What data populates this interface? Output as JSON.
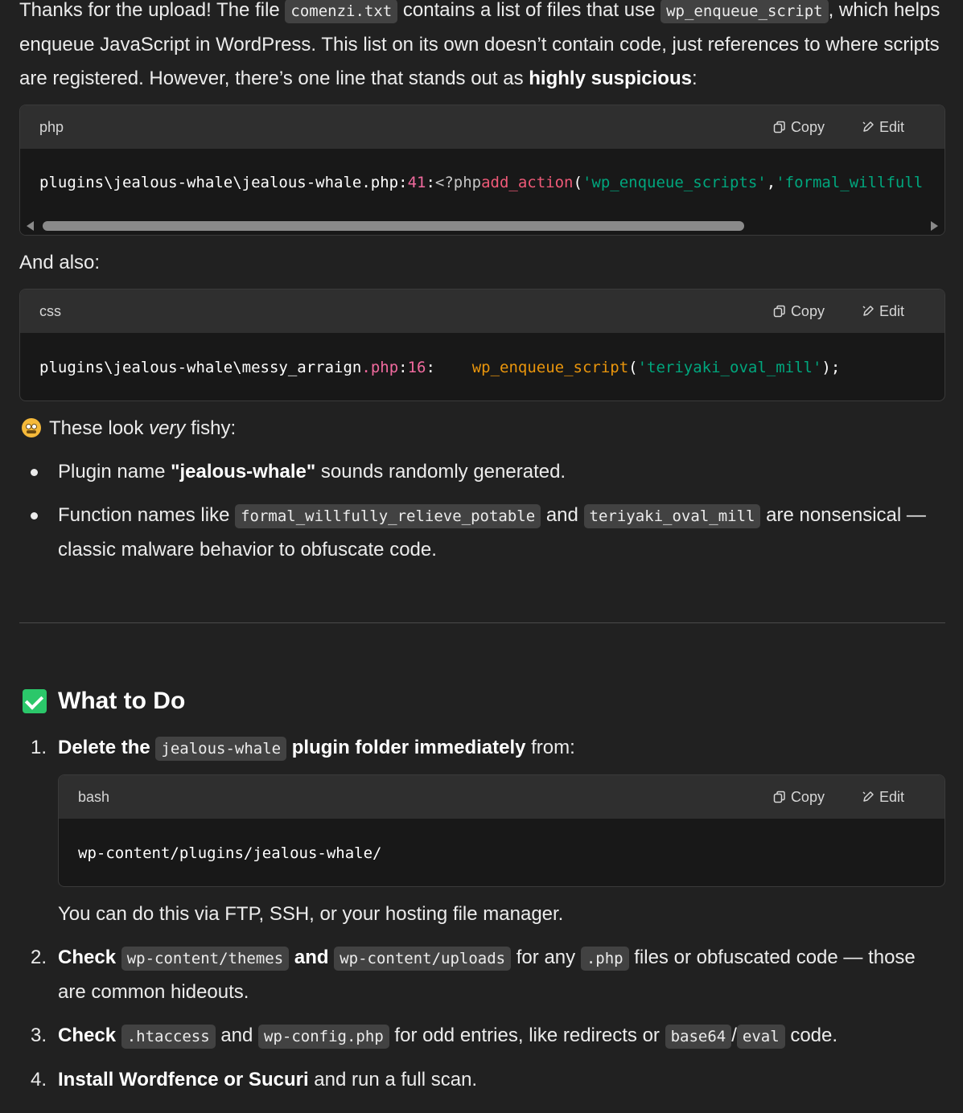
{
  "intro": {
    "t1": "Thanks for the upload! The file ",
    "c1": "comenzi.txt",
    "t2": " contains a list of files that use ",
    "c2": "wp_enqueue_script",
    "t3": ", which helps enqueue JavaScript in WordPress. This list on its own doesn’t contain code, just references to where scripts are registered. However, there’s one line that stands out as ",
    "b1": "highly suspicious",
    "t4": ":"
  },
  "code1": {
    "lang": "php",
    "copy_label": "Copy",
    "edit_label": "Edit",
    "path": "plugins\\jealous-whale\\jealous-whale.php:",
    "line": "41",
    "colon": ":",
    "open_tag": "<?php ",
    "fn": "add_action",
    "paren": "(",
    "arg1": "'wp_enqueue_scripts'",
    "comma": ", ",
    "arg2": "'formal_willfull"
  },
  "and_also": "And also:",
  "code2": {
    "lang": "css",
    "copy_label": "Copy",
    "edit_label": "Edit",
    "path": "plugins\\jealous-whale\\messy_arraign",
    "ext": ".php",
    "colon": ":",
    "line": "16",
    "sep": ":    ",
    "fn": "wp_enqueue_script",
    "paren": "(",
    "arg": "'teriyaki_oval_mill'",
    "close": ");"
  },
  "fishy": {
    "t1": "These look ",
    "em": "very",
    "t2": " fishy:"
  },
  "bullets": {
    "b1_t1": "Plugin name ",
    "b1_b": "\"jealous-whale\"",
    "b1_t2": " sounds randomly generated.",
    "b2_t1": "Function names like ",
    "b2_c1": "formal_willfully_relieve_potable",
    "b2_t2": " and ",
    "b2_c2": "teriyaki_oval_mill",
    "b2_t3": " are nonsensical — classic malware behavior to obfuscate code."
  },
  "section_title": "What to Do",
  "steps": {
    "s1_num": "1.",
    "s1_b1": "Delete the ",
    "s1_c": "jealous-whale",
    "s1_b2": " plugin folder immediately",
    "s1_t": " from:",
    "s1_note": "You can do this via FTP, SSH, or your hosting file manager.",
    "s2_num": "2.",
    "s2_b1": "Check ",
    "s2_c1": "wp-content/themes",
    "s2_b2": " and ",
    "s2_c2": "wp-content/uploads",
    "s2_t1": " for any ",
    "s2_c3": ".php",
    "s2_t2": " files or obfuscated code — those are common hideouts.",
    "s3_num": "3.",
    "s3_b1": "Check ",
    "s3_c1": ".htaccess",
    "s3_t1": " and ",
    "s3_c2": "wp-config.php",
    "s3_t2": " for odd entries, like redirects or ",
    "s3_c3": "base64",
    "s3_t3": "/",
    "s3_c4": "eval",
    "s3_t4": " code.",
    "s4_num": "4.",
    "s4_b": "Install Wordfence or Sucuri",
    "s4_t": " and run a full scan."
  },
  "code3": {
    "lang": "bash",
    "copy_label": "Copy",
    "edit_label": "Edit",
    "text": "wp-content/plugins/jealous-whale/"
  }
}
